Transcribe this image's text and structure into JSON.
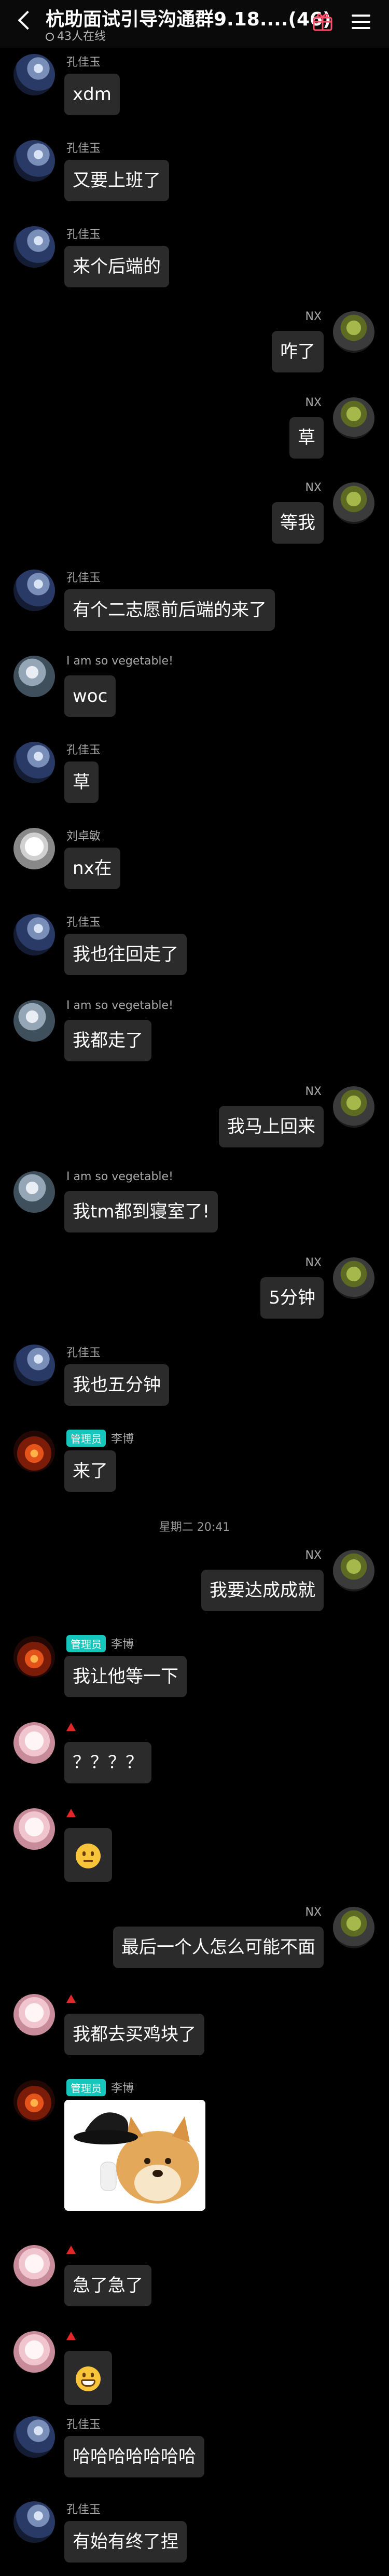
{
  "header": {
    "title": "杭助面试引导沟通群9.18....(46)",
    "online": "43人在线"
  },
  "messages": [
    {
      "sender": "孔佳玉",
      "text": "xdm"
    },
    {
      "sender": "孔佳玉",
      "text": "又要上班了"
    },
    {
      "sender": "孔佳玉",
      "text": "来个后端的"
    },
    {
      "sender": "NX",
      "text": "咋了"
    },
    {
      "sender": "NX",
      "text": "草"
    },
    {
      "sender": "NX",
      "text": "等我"
    },
    {
      "sender": "孔佳玉",
      "text": "有个二志愿前后端的来了"
    },
    {
      "sender": "I am so vegetable!",
      "text": "woc"
    },
    {
      "sender": "孔佳玉",
      "text": "草"
    },
    {
      "sender": "刘卓敏",
      "text": "nx在"
    },
    {
      "sender": "孔佳玉",
      "text": "我也往回走了"
    },
    {
      "sender": "I am so vegetable!",
      "text": "我都走了"
    },
    {
      "sender": "NX",
      "text": "我马上回来"
    },
    {
      "sender": "I am so vegetable!",
      "text": "我tm都到寝室了!"
    },
    {
      "sender": "NX",
      "text": "5分钟"
    },
    {
      "sender": "孔佳玉",
      "text": "我也五分钟"
    },
    {
      "sender": "李博",
      "badge": "管理员",
      "text": "来了"
    },
    {
      "sender": "NX",
      "text": "我要达成成就"
    },
    {
      "sender": "李博",
      "badge": "管理员",
      "text": "我让他等一下"
    },
    {
      "sender": "",
      "text": "？？？？"
    },
    {
      "sender": "",
      "emoji": "neutral-face-emoji"
    },
    {
      "sender": "NX",
      "text": "最后一个人怎么可能不面"
    },
    {
      "sender": "",
      "text": "我都去买鸡块了"
    },
    {
      "sender": "李博",
      "badge": "管理员",
      "sticker": "doge-with-hat-sticker"
    },
    {
      "sender": "",
      "text": "急了急了"
    },
    {
      "sender": "",
      "emoji": "grinning-face-emoji"
    },
    {
      "sender": "孔佳玉",
      "text": "哈哈哈哈哈哈哈"
    },
    {
      "sender": "孔佳玉",
      "text": "有始有终了捏"
    }
  ],
  "timestamp": "星期二 20:41",
  "colors": {
    "admin_badge": "#15c6bd",
    "bubble": "#2b2b2b",
    "background": "#000000",
    "red_mark": "#e0282b"
  },
  "icons": {
    "back": "chevron-left-icon",
    "gift": "gift-icon",
    "menu": "menu-icon",
    "online": "online-indicator-icon"
  }
}
